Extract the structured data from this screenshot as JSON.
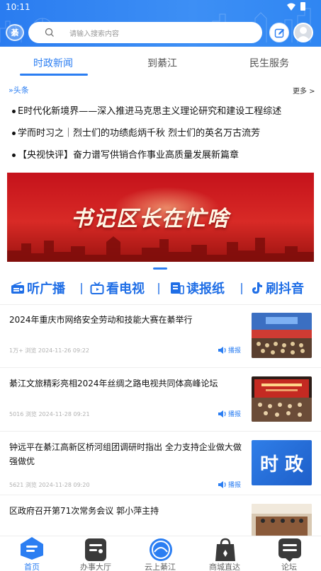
{
  "status": {
    "time": "10:11"
  },
  "header": {
    "logo_text": "綦",
    "search_placeholder": "请输入搜索内容"
  },
  "tabs": [
    {
      "label": "时政新闻",
      "active": true
    },
    {
      "label": "到綦江",
      "active": false
    },
    {
      "label": "民生服务",
      "active": false
    }
  ],
  "headlines": {
    "label": "头条",
    "more": "更多 >",
    "items": [
      "E时代化新境界——深入推进马克思主义理论研究和建设工程综述",
      "学而时习之｜烈士们的功绩彪炳千秋 烈士们的英名万古流芳",
      "【央视快评】奋力谱写供销合作事业高质量发展新篇章"
    ]
  },
  "banner": {
    "title": "书记区长在忙啥"
  },
  "quick_links": [
    {
      "label": "听广播",
      "icon": "radio-icon"
    },
    {
      "label": "看电视",
      "icon": "tv-icon"
    },
    {
      "label": "读报纸",
      "icon": "newspaper-icon"
    },
    {
      "label": "刷抖音",
      "icon": "tiktok-icon"
    }
  ],
  "news": [
    {
      "title": "2024年重庆市网络安全劳动和技能大赛在綦举行",
      "views": "1万+",
      "views_label": "浏览",
      "date": "2024-11-26 09:22",
      "play": "播报"
    },
    {
      "title": "綦江文旅精彩亮相2024年丝绸之路电视共同体高峰论坛",
      "views": "5016",
      "views_label": "浏览",
      "date": "2024-11-28 09:21",
      "play": "播报"
    },
    {
      "title": "钟远平在綦江高新区桥河组团调研时指出 全力支持企业做大做强做优",
      "views": "5621",
      "views_label": "浏览",
      "date": "2024-11-28 09:20",
      "play": "播报",
      "thumb_text": "时 政"
    },
    {
      "title": "区政府召开第71次常务会议 郭小萍主持",
      "views": "",
      "views_label": "",
      "date": "",
      "play": ""
    }
  ],
  "bottom_nav": [
    {
      "label": "首页",
      "active": true
    },
    {
      "label": "办事大厅",
      "active": false
    },
    {
      "label": "云上綦江",
      "active": false
    },
    {
      "label": "商城直达",
      "active": false
    },
    {
      "label": "论坛",
      "active": false
    }
  ],
  "colors": {
    "brand": "#2b7ef2",
    "banner_red": "#d82a26"
  }
}
